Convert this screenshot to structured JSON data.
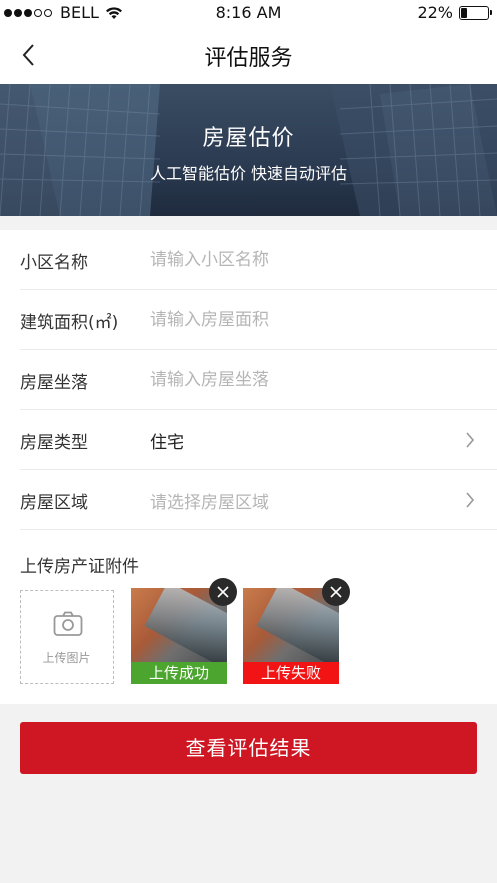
{
  "status_bar": {
    "carrier": "BELL",
    "time": "8:16 AM",
    "battery": "22%",
    "battery_level": 0.22,
    "signal_bars_filled": 3,
    "signal_bars_total": 5
  },
  "nav": {
    "title": "评估服务",
    "back_icon": "chevron-left-icon"
  },
  "banner": {
    "title": "房屋估价",
    "subtitle": "人工智能估价  快速自动评估"
  },
  "form": {
    "community": {
      "label": "小区名称",
      "placeholder": "请输入小区名称"
    },
    "area": {
      "label": "建筑面积(㎡)",
      "placeholder": "请输入房屋面积"
    },
    "location": {
      "label": "房屋坐落",
      "placeholder": "请输入房屋坐落"
    },
    "type": {
      "label": "房屋类型",
      "value": "住宅"
    },
    "region": {
      "label": "房屋区域",
      "placeholder": "请选择房屋区域"
    }
  },
  "upload": {
    "title": "上传房产证附件",
    "add_label": "上传图片",
    "items": [
      {
        "status": "上传成功",
        "status_color": "#4ba52f"
      },
      {
        "status": "上传失败",
        "status_color": "#f21414"
      }
    ]
  },
  "action": {
    "label": "查看评估结果",
    "color": "#cf1723"
  }
}
